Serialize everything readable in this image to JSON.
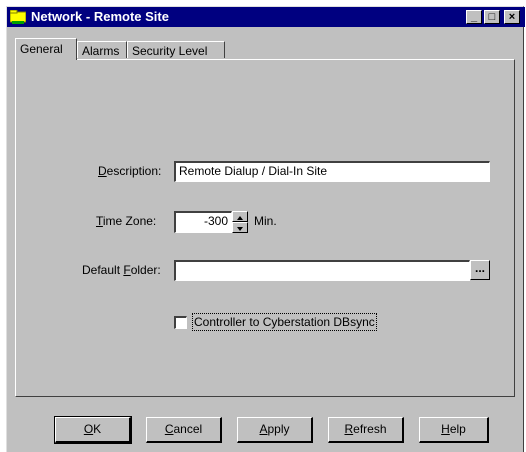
{
  "window": {
    "title": "Network - Remote Site",
    "controls": {
      "minimize": "_",
      "maximize": "□",
      "close": "×"
    }
  },
  "tabs": [
    {
      "label": "General",
      "active": true
    },
    {
      "label": "Alarms",
      "active": false
    },
    {
      "label": "Security Level",
      "active": false
    }
  ],
  "form": {
    "description": {
      "label_key": "D",
      "label_rest": "escription:",
      "value": "Remote Dialup / Dial-In Site"
    },
    "time_zone": {
      "label_key": "T",
      "label_rest": "ime Zone:",
      "value": "-300",
      "unit": "Min."
    },
    "default_folder": {
      "label_pre": "Default ",
      "label_key": "F",
      "label_rest": "older:",
      "value": "",
      "browse_label": "..."
    },
    "dbsync": {
      "label": "Controller to Cyberstation DBsync",
      "checked": false
    }
  },
  "buttons": {
    "ok": {
      "key": "O",
      "rest": "K"
    },
    "cancel": {
      "key": "C",
      "rest": "ancel"
    },
    "apply": {
      "key": "A",
      "rest": "pply"
    },
    "refresh": {
      "key": "R",
      "rest": "efresh"
    },
    "help": {
      "key": "H",
      "rest": "elp"
    }
  }
}
